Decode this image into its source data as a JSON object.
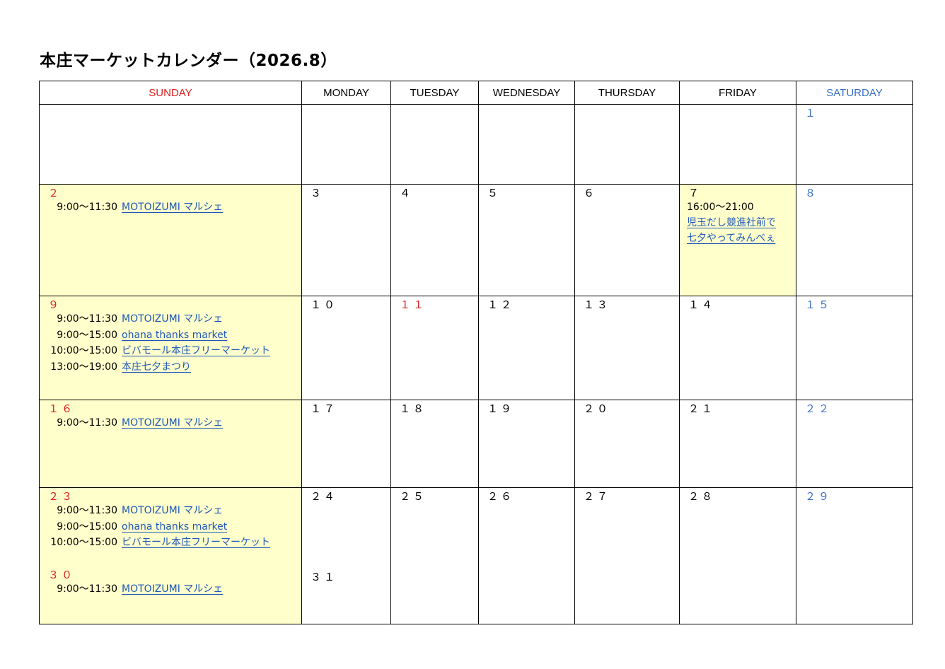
{
  "title": "本庄マーケットカレンダー（2026.8）",
  "weekdays": [
    "SUNDAY",
    "MONDAY",
    "TUESDAY",
    "WEDNESDAY",
    "THURSDAY",
    "FRIDAY",
    "SATURDAY"
  ],
  "colors": {
    "sunday": "#e02020",
    "saturday": "#3a6fc4",
    "highlight": "#ffffcc",
    "link": "#1f58b8"
  },
  "weeks": [
    {
      "days": [
        "",
        "",
        "",
        "",
        "",
        "",
        "１"
      ]
    },
    {
      "days": [
        "２",
        "３",
        "４",
        "５",
        "６",
        "７",
        "８"
      ],
      "sunday_events": [
        {
          "time": "9:00～11:30",
          "name": "MOTOIZUMI マルシェ"
        }
      ],
      "friday_event": {
        "time": "16:00～21:00",
        "name_line1": "児玉だし競進社前で",
        "name_line2": "七夕やってみんべぇ"
      }
    },
    {
      "days": [
        "９",
        "１０",
        "１１",
        "１２",
        "１３",
        "１４",
        "１５"
      ],
      "sunday_events": [
        {
          "time": "9:00～11:30",
          "name": "MOTOIZUMI マルシェ"
        },
        {
          "time": "9:00～15:00",
          "name": "ohana thanks market"
        },
        {
          "time": "10:00～15:00",
          "name": "ビバモール本庄フリーマーケット"
        },
        {
          "time": "13:00～19:00",
          "name": "本庄七夕まつり"
        }
      ]
    },
    {
      "days": [
        "１６",
        "１７",
        "１８",
        "１９",
        "２０",
        "２１",
        "２２"
      ],
      "sunday_events": [
        {
          "time": "9:00～11:30",
          "name": "MOTOIZUMI マルシェ"
        }
      ]
    },
    {
      "days": [
        "２３",
        "２４",
        "２５",
        "２６",
        "２７",
        "２８",
        "２９"
      ],
      "sunday_events": [
        {
          "time": "9:00～11:30",
          "name": "MOTOIZUMI マルシェ"
        },
        {
          "time": "9:00～15:00",
          "name": "ohana thanks market"
        },
        {
          "time": "10:00～15:00",
          "name": "ビバモール本庄フリーマーケット"
        }
      ]
    },
    {
      "days": [
        "３０",
        "３１"
      ],
      "sunday_events": [
        {
          "time": "9:00～11:30",
          "name": "MOTOIZUMI マルシェ"
        }
      ]
    }
  ]
}
